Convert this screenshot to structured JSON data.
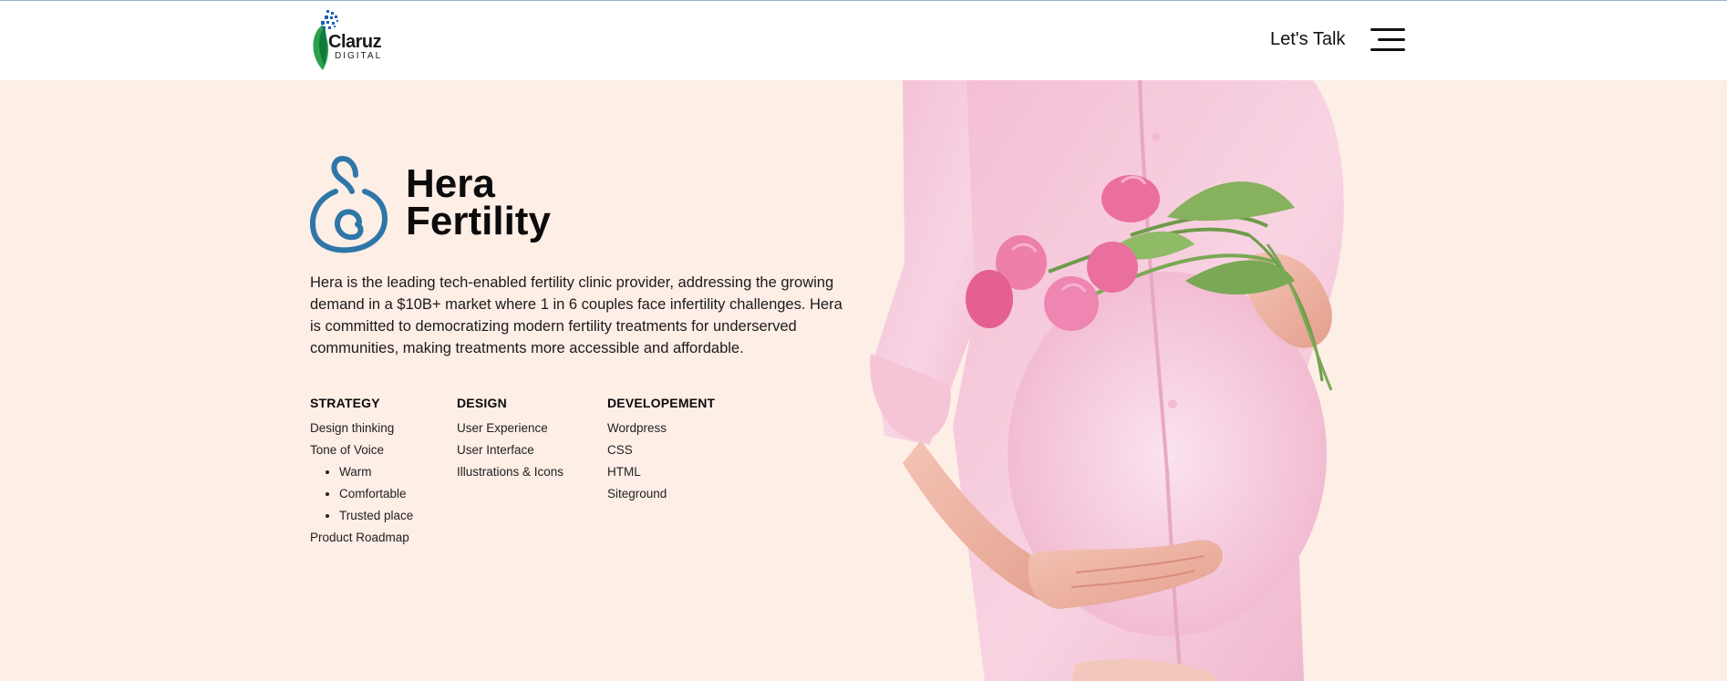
{
  "header": {
    "logo_name": "Claruz",
    "logo_sub": "DIGITAL",
    "lets_talk": "Let's Talk",
    "menu_icon": "hamburger-menu-icon"
  },
  "project": {
    "title_line1": "Hera",
    "title_line2": "Fertility",
    "description": "Hera is the leading tech-enabled fertility clinic provider, addressing the growing demand in a $10B+ market where 1 in 6 couples face infertility challenges. Hera is committed to democratizing modern fertility treatments for underserved communities, making treatments more accessible and affordable."
  },
  "services": {
    "strategy": {
      "heading": "STRATEGY",
      "items": [
        "Design thinking",
        "Tone of Voice"
      ],
      "tone_items": [
        "Warm",
        "Comfortable",
        "Trusted place"
      ],
      "last_item": "Product Roadmap"
    },
    "design": {
      "heading": "DESIGN",
      "items": [
        "User Experience",
        "User Interface",
        "Illustrations & Icons"
      ]
    },
    "development": {
      "heading": "DEVELOPEMENT",
      "items": [
        "Wordpress",
        "CSS",
        "HTML",
        "Siteground"
      ]
    }
  },
  "colors": {
    "background": "#fdeee6",
    "brand_blue": "#2f76a8",
    "shirt_pink": "#f6c6da",
    "tulip_pink": "#ea6f9f"
  }
}
